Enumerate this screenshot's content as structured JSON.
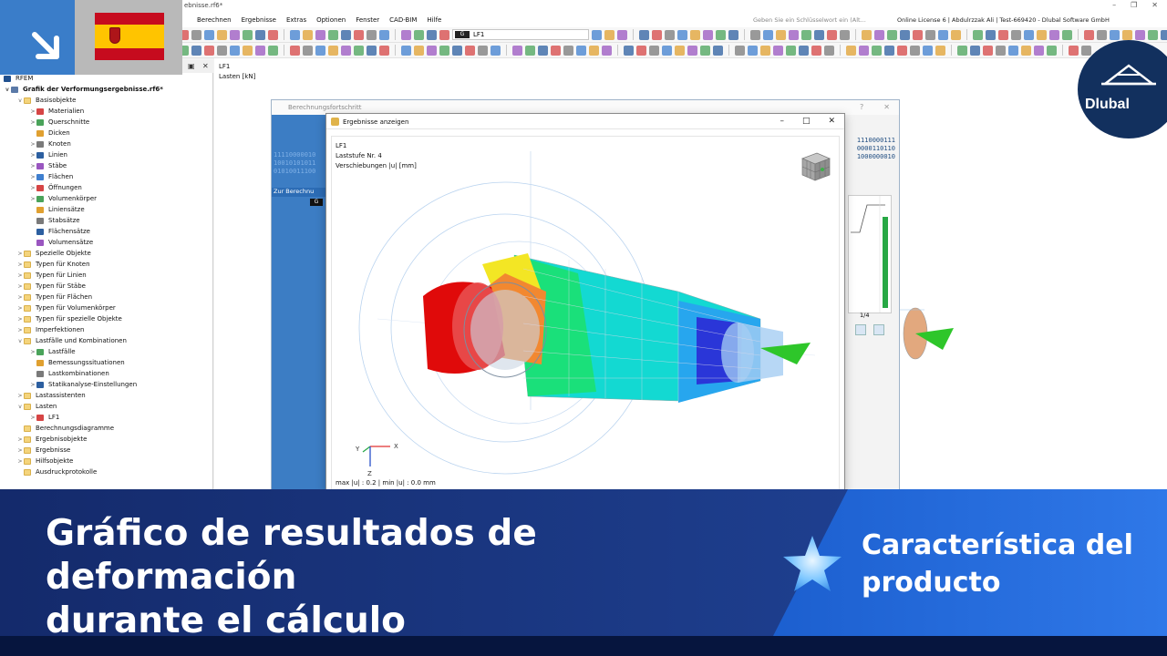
{
  "window": {
    "title": "ebnisse.rf6*",
    "menu": [
      "Berechnen",
      "Ergebnisse",
      "Extras",
      "Optionen",
      "Fenster",
      "CAD-BIM",
      "Hilfe"
    ],
    "search_placeholder": "Geben Sie ein Schlüsselwort ein (Alt...",
    "license": "Online License 6 | Abdulrzzak Ali | Test-669420 - Dlubal Software GmbH",
    "load_case_selector": {
      "badge": "G",
      "value": "LF1"
    }
  },
  "brand": {
    "logo_text": "Dlubal",
    "flag": "spain-flag",
    "corner_icon": "arrow-down-right-icon"
  },
  "navigator": {
    "root": "RFEM",
    "model": "Grafik der Verformungsergebnisse.rf6*",
    "items": [
      {
        "label": "Basisobjekte",
        "level": 1,
        "toggle": "v"
      },
      {
        "label": "Materialien",
        "level": 2,
        "toggle": ">"
      },
      {
        "label": "Querschnitte",
        "level": 2,
        "toggle": ">"
      },
      {
        "label": "Dicken",
        "level": 2,
        "toggle": ""
      },
      {
        "label": "Knoten",
        "level": 2,
        "toggle": ">"
      },
      {
        "label": "Linien",
        "level": 2,
        "toggle": ">"
      },
      {
        "label": "Stäbe",
        "level": 2,
        "toggle": ">"
      },
      {
        "label": "Flächen",
        "level": 2,
        "toggle": ">"
      },
      {
        "label": "Öffnungen",
        "level": 2,
        "toggle": ">"
      },
      {
        "label": "Volumenkörper",
        "level": 2,
        "toggle": ">"
      },
      {
        "label": "Liniensätze",
        "level": 2,
        "toggle": ""
      },
      {
        "label": "Stabsätze",
        "level": 2,
        "toggle": ""
      },
      {
        "label": "Flächensätze",
        "level": 2,
        "toggle": ""
      },
      {
        "label": "Volumensätze",
        "level": 2,
        "toggle": ""
      },
      {
        "label": "Spezielle Objekte",
        "level": 1,
        "toggle": ">"
      },
      {
        "label": "Typen für Knoten",
        "level": 1,
        "toggle": ">"
      },
      {
        "label": "Typen für Linien",
        "level": 1,
        "toggle": ">"
      },
      {
        "label": "Typen für Stäbe",
        "level": 1,
        "toggle": ">"
      },
      {
        "label": "Typen für Flächen",
        "level": 1,
        "toggle": ">"
      },
      {
        "label": "Typen für Volumenkörper",
        "level": 1,
        "toggle": ">"
      },
      {
        "label": "Typen für spezielle Objekte",
        "level": 1,
        "toggle": ">"
      },
      {
        "label": "Imperfektionen",
        "level": 1,
        "toggle": ">"
      },
      {
        "label": "Lastfälle und Kombinationen",
        "level": 1,
        "toggle": "v"
      },
      {
        "label": "Lastfälle",
        "level": 2,
        "toggle": ">"
      },
      {
        "label": "Bemessungssituationen",
        "level": 2,
        "toggle": ""
      },
      {
        "label": "Lastkombinationen",
        "level": 2,
        "toggle": ""
      },
      {
        "label": "Statikanalyse-Einstellungen",
        "level": 2,
        "toggle": ">"
      },
      {
        "label": "Lastassistenten",
        "level": 1,
        "toggle": ">"
      },
      {
        "label": "Lasten",
        "level": 1,
        "toggle": "v"
      },
      {
        "label": "LF1",
        "level": 2,
        "toggle": ">"
      },
      {
        "label": "Berechnungsdiagramme",
        "level": 1,
        "toggle": ""
      },
      {
        "label": "Ergebnisobjekte",
        "level": 1,
        "toggle": ">"
      },
      {
        "label": "Ergebnisse",
        "level": 1,
        "toggle": ">"
      },
      {
        "label": "Hilfsobjekte",
        "level": 1,
        "toggle": ">"
      },
      {
        "label": "Ausdruckprotokolle",
        "level": 1,
        "toggle": ""
      }
    ]
  },
  "workarea": {
    "lf": "LF1",
    "unit_label": "Lasten [kN]"
  },
  "progress_window": {
    "title": "Berechnungsfortschritt",
    "side_label": "Zur Berechnu",
    "side_badge": "G",
    "binary_left": [
      "11110000010",
      "10010101011",
      "01010011100"
    ],
    "binary_right": [
      "1110000111",
      "0000110110",
      "1000000010"
    ],
    "ratio": "1/4"
  },
  "results_dialog": {
    "title": "Ergebnisse anzeigen",
    "info": [
      "LF1",
      "Laststufe Nr. 4",
      "Verschiebungen |u| [mm]"
    ],
    "maxmin": "max |u| : 0.2 | min |u| : 0.0 mm",
    "axes": {
      "x": "X",
      "y": "Y",
      "z": "Z"
    }
  },
  "banner": {
    "headline_line1": "Gráfico de resultados de deformación",
    "headline_line2": "durante el cálculo",
    "feature_line1": "Característica del",
    "feature_line2": "producto"
  },
  "colors": {
    "banner_dark": "#1e3f8f",
    "banner_accent": "#2f78e8",
    "brand_blue": "#3a7dc9",
    "dlubal_navy": "#12305e"
  }
}
